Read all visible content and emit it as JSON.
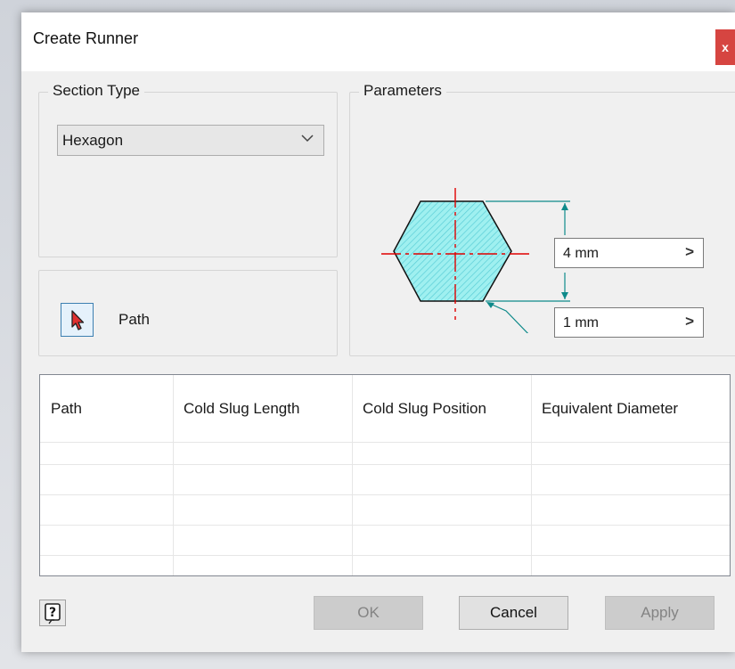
{
  "dialog": {
    "title": "Create Runner",
    "close_label": "x"
  },
  "section_type": {
    "legend": "Section Type",
    "selected": "Hexagon"
  },
  "path_selector": {
    "label": "Path"
  },
  "parameters": {
    "legend": "Parameters",
    "size_value": "4 mm",
    "corner_value": "1 mm",
    "arrow_glyph": ">"
  },
  "table": {
    "columns": [
      "Path",
      "Cold Slug Length",
      "Cold Slug Position",
      "Equivalent Diameter"
    ],
    "rows": []
  },
  "buttons": {
    "help_glyph": "?",
    "ok": "OK",
    "cancel": "Cancel",
    "apply": "Apply"
  },
  "colors": {
    "close": "#d64541",
    "dimension_lines": "#0e8a8a",
    "hexagon_fill": "#9ff0f0",
    "centerline": "#e00000"
  }
}
